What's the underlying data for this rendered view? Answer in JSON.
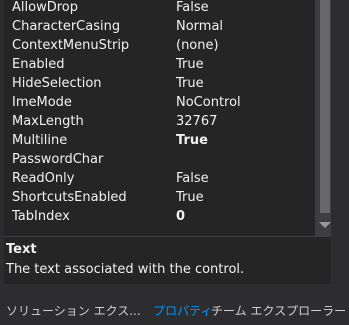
{
  "properties": [
    {
      "name": "AllowDrop",
      "value": "False",
      "bold": false
    },
    {
      "name": "CharacterCasing",
      "value": "Normal",
      "bold": false
    },
    {
      "name": "ContextMenuStrip",
      "value": "(none)",
      "bold": false
    },
    {
      "name": "Enabled",
      "value": "True",
      "bold": false
    },
    {
      "name": "HideSelection",
      "value": "True",
      "bold": false
    },
    {
      "name": "ImeMode",
      "value": "NoControl",
      "bold": false
    },
    {
      "name": "MaxLength",
      "value": "32767",
      "bold": false
    },
    {
      "name": "Multiline",
      "value": "True",
      "bold": true
    },
    {
      "name": "PasswordChar",
      "value": "",
      "bold": false
    },
    {
      "name": "ReadOnly",
      "value": "False",
      "bold": false
    },
    {
      "name": "ShortcutsEnabled",
      "value": "True",
      "bold": false
    },
    {
      "name": "TabIndex",
      "value": "0",
      "bold": true
    }
  ],
  "description": {
    "title": "Text",
    "text": "The text associated with the control."
  },
  "tabs": [
    {
      "label": "ソリューション エクス...",
      "active": false
    },
    {
      "label": "プロパティ",
      "active": true
    },
    {
      "label": "チーム エクスプローラー",
      "active": false
    }
  ],
  "colors": {
    "background": "#2d2d30",
    "grid": "#252526",
    "active_tab": "#0097fb"
  }
}
